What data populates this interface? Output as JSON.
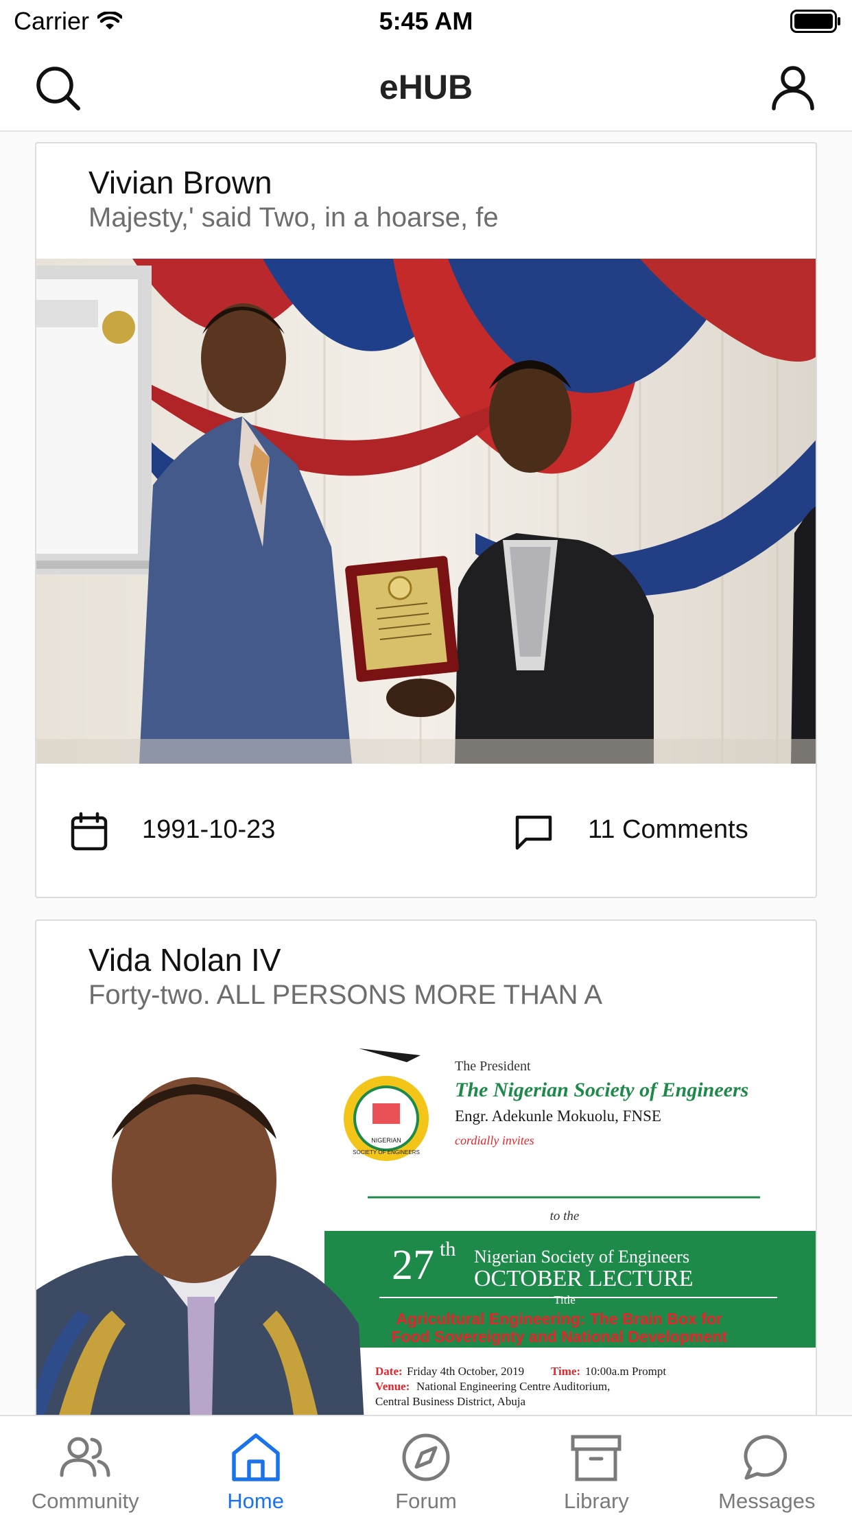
{
  "status_bar": {
    "carrier": "Carrier",
    "time": "5:45 AM"
  },
  "header": {
    "title": "eHUB",
    "left_icon": "search-icon",
    "right_icon": "profile-icon"
  },
  "posts": [
    {
      "author": "Vivian Brown",
      "excerpt": "Majesty,' said Two, in a hoarse, fe",
      "date": "1991-10-23",
      "comments": "11 Comments",
      "image": "photo of two men shaking hands while holding an award plaque"
    },
    {
      "author": "Vida Nolan IV",
      "excerpt": "Forty-two. ALL PERSONS MORE THAN A",
      "flyer": {
        "intro": "The President",
        "org": "The Nigerian Society of Engineers",
        "name": "Engr. Adekunle Mokuolu, FNSE",
        "invite": "cordially invites",
        "to_the": "to the",
        "ordinal": "27",
        "ordinal_suffix": "th",
        "lecture_line1": "Nigerian Society of Engineers",
        "lecture_line2": "OCTOBER LECTURE",
        "title_label": "Title",
        "topic_line1": "Agricultural Engineering: The Brain Box for",
        "topic_line2": "Food Sovereignty and National Development",
        "date_label": "Date:",
        "date_value": "Friday 4th October, 2019",
        "time_label": "Time:",
        "time_value": "10:00a.m Prompt",
        "venue_label": "Venue:",
        "venue_value": "National Engineering Centre Auditorium,",
        "venue_value2": "Central Business District, Abuja",
        "logo_text_top": "NIGERIAN",
        "logo_text_bottom": "SOCIETY OF ENGINEERS"
      }
    }
  ],
  "tabs": [
    {
      "label": "Community",
      "icon": "users-icon",
      "active": false
    },
    {
      "label": "Home",
      "icon": "home-icon",
      "active": true
    },
    {
      "label": "Forum",
      "icon": "compass-icon",
      "active": false
    },
    {
      "label": "Library",
      "icon": "archive-icon",
      "active": false
    },
    {
      "label": "Messages",
      "icon": "chat-bubble-icon",
      "active": false
    }
  ],
  "colors": {
    "accent": "#1a73e8",
    "tab_inactive": "#7a7a7a",
    "excerpt": "#6d6d6d",
    "flyer_green": "#1e8a4a",
    "flyer_red": "#e3262c"
  }
}
